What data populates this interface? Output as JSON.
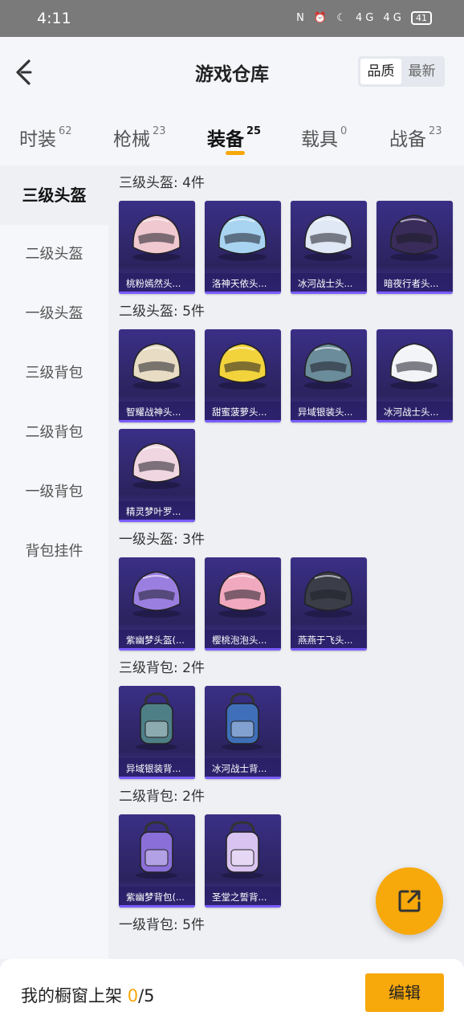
{
  "status_bar": {
    "time": "4:11",
    "icons": "N ⏰ ☾ 4G 4G",
    "battery": "41"
  },
  "header": {
    "title": "游戏仓库",
    "sort": [
      "品质",
      "最新"
    ]
  },
  "tabs": [
    {
      "label": "时装",
      "count": "62"
    },
    {
      "label": "枪械",
      "count": "23"
    },
    {
      "label": "装备",
      "count": "25"
    },
    {
      "label": "载具",
      "count": "0"
    },
    {
      "label": "战备",
      "count": "23"
    }
  ],
  "sidebar": [
    "三级头盔",
    "二级头盔",
    "一级头盔",
    "三级背包",
    "二级背包",
    "一级背包",
    "背包挂件"
  ],
  "sections": [
    {
      "title": "三级头盔: 4件",
      "items": [
        {
          "name": "桃粉嫣然头...",
          "icon": "helmet-icon",
          "color": "#f0c8cf"
        },
        {
          "name": "洛神天依头...",
          "icon": "helmet-icon",
          "color": "#a8d4f2"
        },
        {
          "name": "冰河战士头...",
          "icon": "helmet-icon",
          "color": "#dfe8f4"
        },
        {
          "name": "暗夜行者头...",
          "icon": "helmet-icon",
          "color": "#3a2c5a"
        }
      ]
    },
    {
      "title": "二级头盔: 5件",
      "items": [
        {
          "name": "智耀战神头...",
          "icon": "helmet-icon",
          "color": "#e8dcc4"
        },
        {
          "name": "甜蜜菠萝头...",
          "icon": "helmet-icon",
          "color": "#f3d33c"
        },
        {
          "name": "异域银装头...",
          "icon": "helmet-icon",
          "color": "#6b8c9a"
        },
        {
          "name": "冰河战士头...",
          "icon": "helmet-icon",
          "color": "#f2f4f8"
        },
        {
          "name": "精灵梦叶罗...",
          "icon": "helmet-icon",
          "color": "#f0d6e0"
        }
      ]
    },
    {
      "title": "一级头盔: 3件",
      "items": [
        {
          "name": "紫幽梦头盔(...",
          "icon": "helmet-icon",
          "color": "#9b7fe0"
        },
        {
          "name": "樱桃泡泡头...",
          "icon": "helmet-icon",
          "color": "#f1a9bf"
        },
        {
          "name": "燕燕于飞头...",
          "icon": "helmet-icon",
          "color": "#3b3e48"
        }
      ]
    },
    {
      "title": "三级背包: 2件",
      "items": [
        {
          "name": "异域银装背...",
          "icon": "backpack-icon",
          "color": "#4f7f86"
        },
        {
          "name": "冰河战士背...",
          "icon": "backpack-icon",
          "color": "#3f6fb8"
        }
      ]
    },
    {
      "title": "二级背包: 2件",
      "items": [
        {
          "name": "紫幽梦背包(...",
          "icon": "backpack-icon",
          "color": "#8a6fd8"
        },
        {
          "name": "圣堂之誓背...",
          "icon": "backpack-icon",
          "color": "#d9c3f0"
        }
      ]
    },
    {
      "title": "一级背包: 5件",
      "items": []
    }
  ],
  "bottom": {
    "label_prefix": "我的橱窗上架",
    "current": "0",
    "total_sep": "/5",
    "edit": "编辑"
  },
  "colors": {
    "accent": "#f7a80a",
    "card_bg": "#3a2f86"
  }
}
